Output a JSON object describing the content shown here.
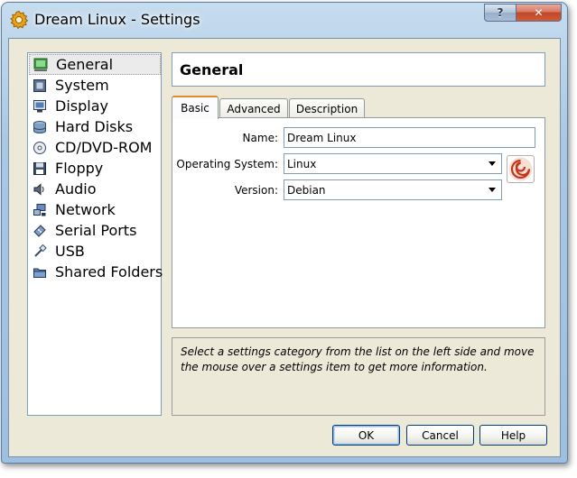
{
  "window": {
    "title": "Dream Linux - Settings",
    "help_label": "?",
    "close_label": "✕"
  },
  "sidebar": {
    "items": [
      {
        "label": "General",
        "icon": "general-icon",
        "selected": true
      },
      {
        "label": "System",
        "icon": "system-icon"
      },
      {
        "label": "Display",
        "icon": "display-icon"
      },
      {
        "label": "Hard Disks",
        "icon": "hard-disks-icon"
      },
      {
        "label": "CD/DVD-ROM",
        "icon": "cd-dvd-icon"
      },
      {
        "label": "Floppy",
        "icon": "floppy-icon"
      },
      {
        "label": "Audio",
        "icon": "audio-icon"
      },
      {
        "label": "Network",
        "icon": "network-icon"
      },
      {
        "label": "Serial Ports",
        "icon": "serial-ports-icon"
      },
      {
        "label": "USB",
        "icon": "usb-icon"
      },
      {
        "label": "Shared Folders",
        "icon": "shared-folders-icon"
      }
    ]
  },
  "header": {
    "title": "General"
  },
  "tabs": [
    {
      "label": "Basic",
      "active": true
    },
    {
      "label": "Advanced"
    },
    {
      "label": "Description"
    }
  ],
  "basic": {
    "name_label": "Name:",
    "name_value": "Dream Linux",
    "os_label": "Operating System:",
    "os_value": "Linux",
    "version_label": "Version:",
    "version_value": "Debian"
  },
  "info": {
    "text": "Select a settings category from the list on the left side and move the mouse over a settings item to get more information."
  },
  "buttons": {
    "ok": "OK",
    "cancel": "Cancel",
    "help": "Help"
  },
  "colors": {
    "title_bar": "#aac8e4",
    "client_bg": "#ece9d8",
    "selection_bg": "#ebebeb",
    "active_tab_accent": "#e68b2c",
    "close_button": "#c2472a"
  }
}
